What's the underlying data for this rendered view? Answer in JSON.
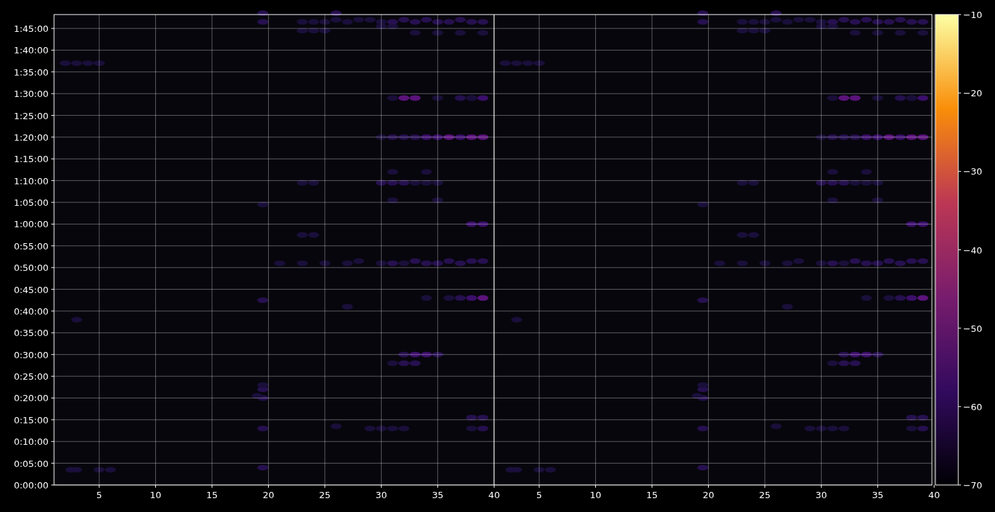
{
  "plot": {
    "y_tick_labels": [
      "1:45:00",
      "1:40:00",
      "1:35:00",
      "1:30:00",
      "1:25:00",
      "1:20:00",
      "1:15:00",
      "1:10:00",
      "1:05:00",
      "1:00:00",
      "0:55:00",
      "0:50:00",
      "0:45:00",
      "0:40:00",
      "0:35:00",
      "0:30:00",
      "0:25:00",
      "0:20:00",
      "0:15:00",
      "0:10:00",
      "0:05:00",
      "0:00:00"
    ],
    "x_tick_labels": [
      "5",
      "10",
      "15",
      "20",
      "25",
      "30",
      "35",
      "40",
      "5",
      "10",
      "15",
      "20",
      "25",
      "30",
      "35",
      "40"
    ]
  },
  "colorbar": {
    "tick_labels": [
      "−10",
      "−20",
      "−30",
      "−40",
      "−50",
      "−60",
      "−70"
    ]
  }
}
